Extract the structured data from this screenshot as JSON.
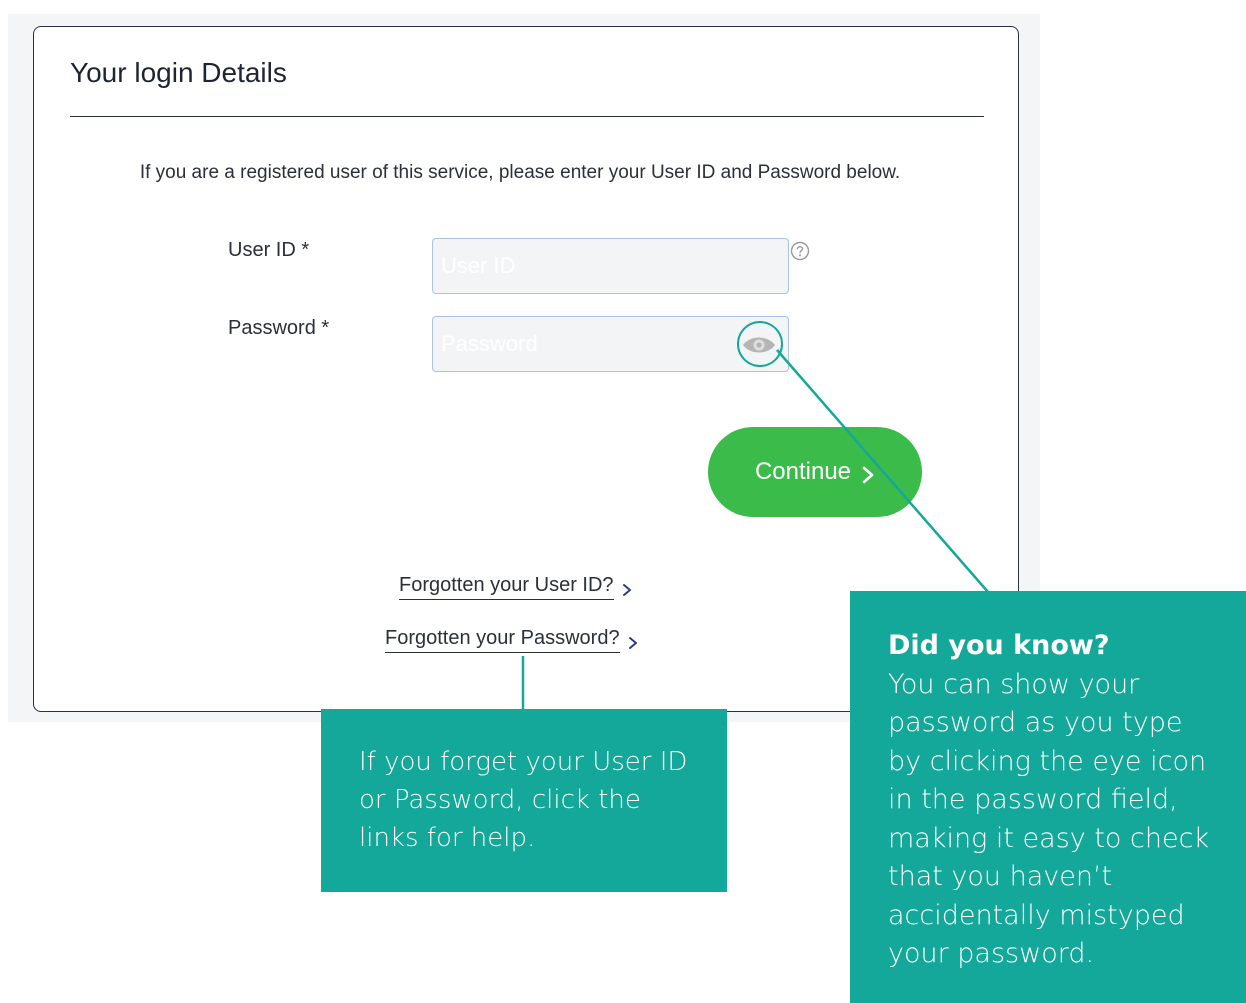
{
  "panel": {
    "title": "Your login Details",
    "intro": "If you are a registered user of this service, please enter your User ID and Password below."
  },
  "form": {
    "user_id": {
      "label": "User ID *",
      "placeholder": "User ID",
      "value": ""
    },
    "password": {
      "label": "Password *",
      "placeholder": "Password",
      "value": ""
    },
    "help_icon": "question-circle-icon",
    "toggle_icon": "eye-icon",
    "continue_label": "Continue"
  },
  "links": {
    "forgot_user_id": "Forgotten your User ID?",
    "forgot_password": "Forgotten your Password?"
  },
  "callouts": {
    "links_help": "If you forget your User ID or Password, click the links for help.",
    "eye_title": "Did you know?",
    "eye_body": "You can show your password as you type by clicking the eye icon in the password field, making it easy to check that you haven’t accidentally mistyped your password."
  },
  "colors": {
    "accent_teal": "#14a89a",
    "button_green": "#3bbb4a",
    "input_border": "#a9c2e6",
    "panel_border": "#2a2f45"
  }
}
